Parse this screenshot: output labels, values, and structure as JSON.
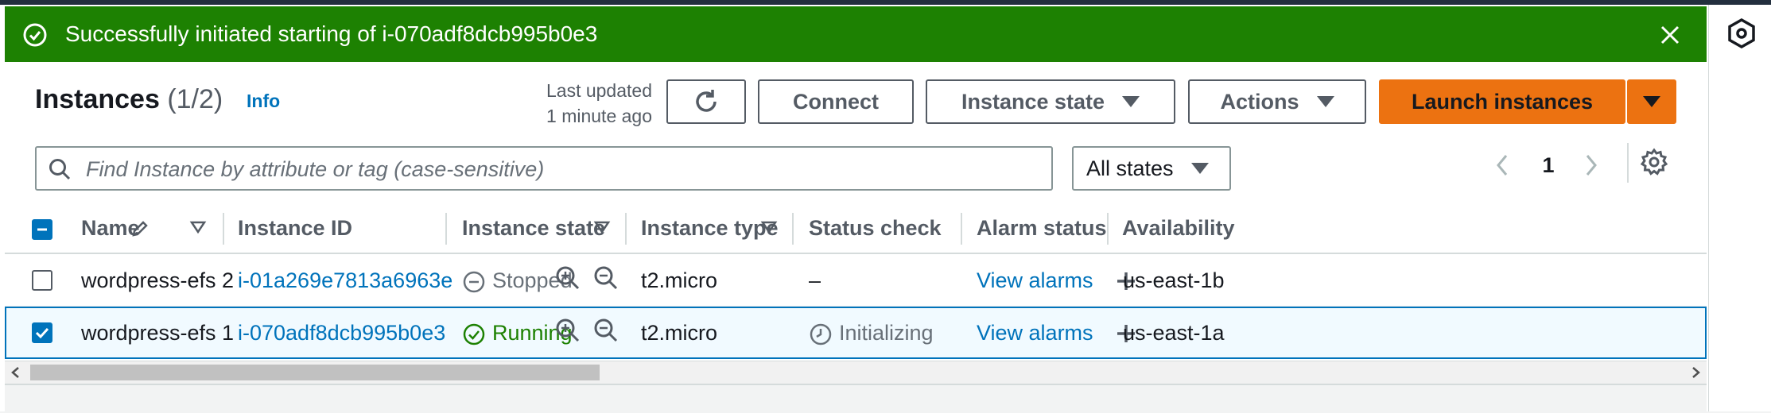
{
  "flash": {
    "message": "Successfully initiated starting of i-070adf8dcb995b0e3",
    "type": "success"
  },
  "header": {
    "title": "Instances",
    "count": "(1/2)",
    "info_label": "Info",
    "last_updated_line1": "Last updated",
    "last_updated_line2": "1 minute ago"
  },
  "toolbar": {
    "connect_label": "Connect",
    "instance_state_label": "Instance state",
    "actions_label": "Actions",
    "launch_label": "Launch instances"
  },
  "search": {
    "placeholder": "Find Instance by attribute or tag (case-sensitive)",
    "value": ""
  },
  "filter": {
    "selected": "All states"
  },
  "pagination": {
    "current_page": "1"
  },
  "table": {
    "columns": {
      "name": "Name",
      "instance_id": "Instance ID",
      "instance_state": "Instance state",
      "instance_type": "Instance type",
      "status_check": "Status check",
      "alarm_status": "Alarm status",
      "availability": "Availability"
    },
    "rows": [
      {
        "name": "wordpress-efs 2",
        "instance_id": "i-01a269e7813a6963e",
        "state": "Stopped",
        "type": "t2.micro",
        "status_check": "–",
        "alarm": "View alarms",
        "az": "us-east-1b",
        "selected": false
      },
      {
        "name": "wordpress-efs 1",
        "instance_id": "i-070adf8dcb995b0e3",
        "state": "Running",
        "type": "t2.micro",
        "status_check": "Initializing",
        "alarm": "View alarms",
        "az": "us-east-1a",
        "selected": true
      }
    ]
  },
  "colors": {
    "success_green": "#1d8102",
    "link_blue": "#0073bb",
    "primary_orange": "#ec7211",
    "selected_row_bg": "#f1faff"
  }
}
